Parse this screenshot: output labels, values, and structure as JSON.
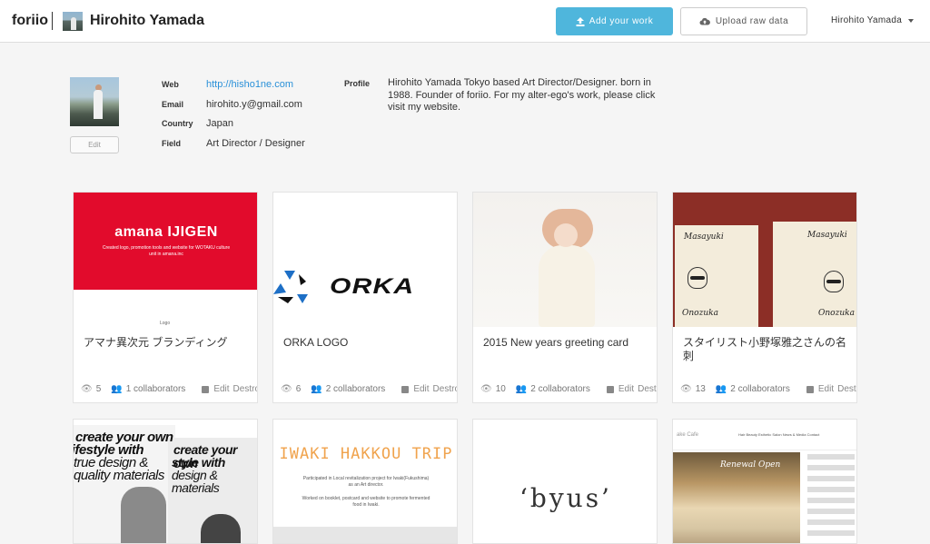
{
  "header": {
    "brand": "foriio",
    "user_name": "Hirohito Yamada",
    "add_work_label": "Add your work",
    "upload_label": "Upload raw data",
    "menu_user": "Hirohito Yamada"
  },
  "profile": {
    "edit_label": "Edit",
    "web_label": "Web",
    "web_value": "http://hisho1ne.com",
    "email_label": "Email",
    "email_value": "hirohito.y@gmail.com",
    "country_label": "Country",
    "country_value": "Japan",
    "field_label": "Field",
    "field_value": "Art Director / Designer",
    "profile_label": "Profile",
    "profile_text": "Hirohito Yamada Tokyo based Art Director/Designer. born in 1988. Founder of foriio. For my alter-ego's work, please click visit my website."
  },
  "works": [
    {
      "title": "アマナ異次元 ブランディング",
      "views": "5",
      "collaborators": "1 collaborators",
      "edit": "Edit",
      "destroy": "Destroy",
      "image_title": "amana IJIGEN",
      "image_sub": "Created logo, promotion tools and website for WOTAKU culture unit in amana.inc",
      "image_footer": "Logo"
    },
    {
      "title": "ORKA LOGO",
      "views": "6",
      "collaborators": "2 collaborators",
      "edit": "Edit",
      "destroy": "Destroy",
      "image_text": "ORKA"
    },
    {
      "title": "2015 New years greeting card",
      "views": "10",
      "collaborators": "2 collaborators",
      "edit": "Edit",
      "destroy": "Destroy"
    },
    {
      "title": "スタイリスト小野塚雅之さんの名刺",
      "views": "13",
      "collaborators": "2 collaborators",
      "edit": "Edit",
      "destroy": "Destroy",
      "image_name_top": "Masayuki",
      "image_name_bottom": "Onozuka"
    },
    {
      "image_text_1": "create your own",
      "image_text_2": "lifestyle with",
      "image_text_3": "true design &",
      "image_text_4": "quality materials",
      "image_text_b1": "create your own",
      "image_text_b2": "style with",
      "image_text_b3": "design &",
      "image_text_b4": "materials"
    },
    {
      "image_title": "IWAKI HAKKOU TRIP",
      "image_sub": "Participated in Local revitalization project for Iwaki(Fukushima) as an Art director.",
      "image_sub2": "Worked on booklet, postcard and website to promote fermented food in Iwaki."
    },
    {
      "image_text": "‘byus’"
    },
    {
      "image_logo": "ake Cafe",
      "image_nav": "Hair Beauty   Esthetic   Salon   News & Media   Contact",
      "image_banner": "Renewal Open"
    }
  ]
}
